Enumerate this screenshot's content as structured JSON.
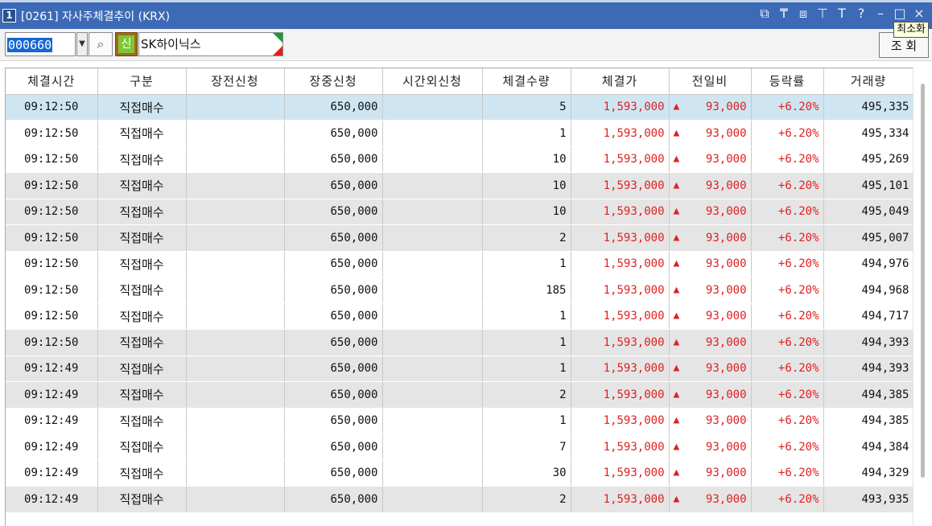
{
  "window": {
    "number": "1",
    "title": "[0261] 자사주체결추이 (KRX)",
    "tooltip": "최소화"
  },
  "toolbar": {
    "stock_code": "000660",
    "credit_label": "신",
    "stock_name": "SK하이닉스",
    "query_label": "조 회"
  },
  "table": {
    "columns": [
      "체결시간",
      "구분",
      "장전신청",
      "장중신청",
      "시간외신청",
      "체결수량",
      "체결가",
      "전일비",
      "등락률",
      "거래량"
    ],
    "rows": [
      {
        "time": "09:12:50",
        "type": "직접매수",
        "pre": "",
        "intra": "650,000",
        "after": "",
        "qty": "5",
        "price": "1,593,000",
        "change": "93,000",
        "rate": "+6.20%",
        "volume": "495,335"
      },
      {
        "time": "09:12:50",
        "type": "직접매수",
        "pre": "",
        "intra": "650,000",
        "after": "",
        "qty": "1",
        "price": "1,593,000",
        "change": "93,000",
        "rate": "+6.20%",
        "volume": "495,334"
      },
      {
        "time": "09:12:50",
        "type": "직접매수",
        "pre": "",
        "intra": "650,000",
        "after": "",
        "qty": "10",
        "price": "1,593,000",
        "change": "93,000",
        "rate": "+6.20%",
        "volume": "495,269"
      },
      {
        "time": "09:12:50",
        "type": "직접매수",
        "pre": "",
        "intra": "650,000",
        "after": "",
        "qty": "10",
        "price": "1,593,000",
        "change": "93,000",
        "rate": "+6.20%",
        "volume": "495,101"
      },
      {
        "time": "09:12:50",
        "type": "직접매수",
        "pre": "",
        "intra": "650,000",
        "after": "",
        "qty": "10",
        "price": "1,593,000",
        "change": "93,000",
        "rate": "+6.20%",
        "volume": "495,049"
      },
      {
        "time": "09:12:50",
        "type": "직접매수",
        "pre": "",
        "intra": "650,000",
        "after": "",
        "qty": "2",
        "price": "1,593,000",
        "change": "93,000",
        "rate": "+6.20%",
        "volume": "495,007"
      },
      {
        "time": "09:12:50",
        "type": "직접매수",
        "pre": "",
        "intra": "650,000",
        "after": "",
        "qty": "1",
        "price": "1,593,000",
        "change": "93,000",
        "rate": "+6.20%",
        "volume": "494,976"
      },
      {
        "time": "09:12:50",
        "type": "직접매수",
        "pre": "",
        "intra": "650,000",
        "after": "",
        "qty": "185",
        "price": "1,593,000",
        "change": "93,000",
        "rate": "+6.20%",
        "volume": "494,968"
      },
      {
        "time": "09:12:50",
        "type": "직접매수",
        "pre": "",
        "intra": "650,000",
        "after": "",
        "qty": "1",
        "price": "1,593,000",
        "change": "93,000",
        "rate": "+6.20%",
        "volume": "494,717"
      },
      {
        "time": "09:12:50",
        "type": "직접매수",
        "pre": "",
        "intra": "650,000",
        "after": "",
        "qty": "1",
        "price": "1,593,000",
        "change": "93,000",
        "rate": "+6.20%",
        "volume": "494,393"
      },
      {
        "time": "09:12:49",
        "type": "직접매수",
        "pre": "",
        "intra": "650,000",
        "after": "",
        "qty": "1",
        "price": "1,593,000",
        "change": "93,000",
        "rate": "+6.20%",
        "volume": "494,393"
      },
      {
        "time": "09:12:49",
        "type": "직접매수",
        "pre": "",
        "intra": "650,000",
        "after": "",
        "qty": "2",
        "price": "1,593,000",
        "change": "93,000",
        "rate": "+6.20%",
        "volume": "494,385"
      },
      {
        "time": "09:12:49",
        "type": "직접매수",
        "pre": "",
        "intra": "650,000",
        "after": "",
        "qty": "1",
        "price": "1,593,000",
        "change": "93,000",
        "rate": "+6.20%",
        "volume": "494,385"
      },
      {
        "time": "09:12:49",
        "type": "직접매수",
        "pre": "",
        "intra": "650,000",
        "after": "",
        "qty": "7",
        "price": "1,593,000",
        "change": "93,000",
        "rate": "+6.20%",
        "volume": "494,384"
      },
      {
        "time": "09:12:49",
        "type": "직접매수",
        "pre": "",
        "intra": "650,000",
        "after": "",
        "qty": "30",
        "price": "1,593,000",
        "change": "93,000",
        "rate": "+6.20%",
        "volume": "494,329"
      },
      {
        "time": "09:12:49",
        "type": "직접매수",
        "pre": "",
        "intra": "650,000",
        "after": "",
        "qty": "2",
        "price": "1,593,000",
        "change": "93,000",
        "rate": "+6.20%",
        "volume": "493,935"
      }
    ]
  },
  "icons": {
    "up_arrow": "▲"
  },
  "colors": {
    "title_bar": "#3d6ab7",
    "up_red": "#e02020",
    "selected_row": "#cfe6f2",
    "gray_row": "#e5e5e5"
  }
}
